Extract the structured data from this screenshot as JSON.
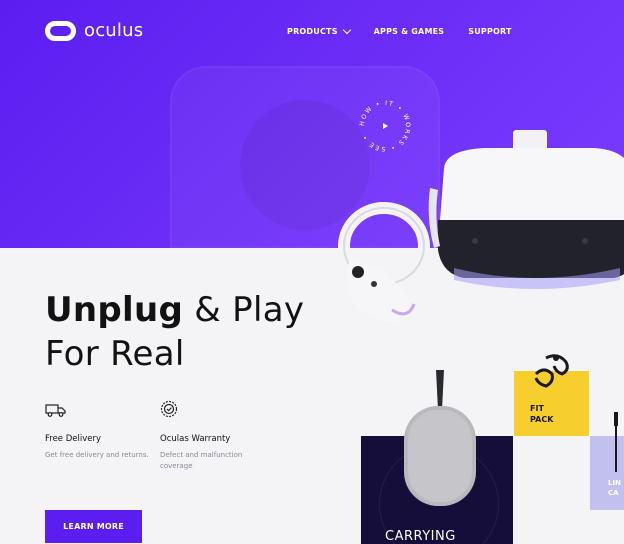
{
  "brand": {
    "name": "oculus"
  },
  "nav": {
    "items": [
      {
        "label": "PRODUCTS",
        "has_dropdown": true
      },
      {
        "label": "APPS & GAMES",
        "has_dropdown": false
      },
      {
        "label": "SUPPORT",
        "has_dropdown": false
      }
    ]
  },
  "hero": {
    "badge_text": "HOW • IT • WORKS • SEE •",
    "headline_bold": "Unplug",
    "headline_rest_1": " & Play",
    "headline_line2": "For Real"
  },
  "features": [
    {
      "icon": "truck-icon",
      "title": "Free Delivery",
      "description": "Get free delivery and returns."
    },
    {
      "icon": "warranty-badge-icon",
      "title": "Oculas Warranty",
      "description": "Defect and malfunction coverage"
    }
  ],
  "cta": {
    "label": "LEARN MORE"
  },
  "product_cards": [
    {
      "label": "CARRYING",
      "color": "#150d3a"
    },
    {
      "label_line1": "FIT",
      "label_line2": "PACK",
      "color": "#f6cf2f"
    },
    {
      "label_line1": "LIN",
      "label_line2": "CA",
      "color": "#c2c0ee"
    }
  ],
  "colors": {
    "brand_purple": "#5a1ef0",
    "dark_card": "#150d3a",
    "yellow_card": "#f6cf2f",
    "lavender_card": "#c2c0ee"
  }
}
